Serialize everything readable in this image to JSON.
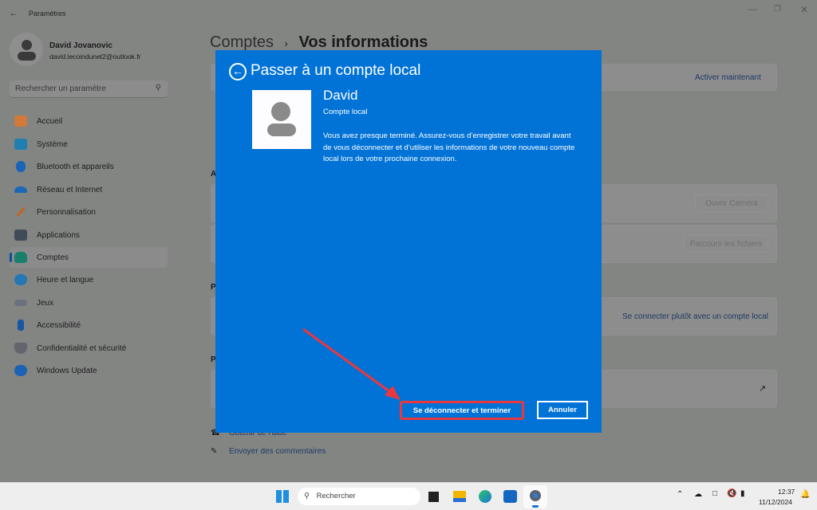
{
  "window": {
    "title": "Paramètres"
  },
  "user": {
    "name": "David Jovanovic",
    "email": "david.lecoindunet2@outlook.fr"
  },
  "search": {
    "placeholder": "Rechercher un paramètre"
  },
  "sidebar": {
    "items": [
      {
        "label": "Accueil",
        "icon": "home-icon",
        "color": "#e07a3a"
      },
      {
        "label": "Système",
        "icon": "system-icon",
        "color": "#1e8fc9"
      },
      {
        "label": "Bluetooth et appareils",
        "icon": "bluetooth-icon",
        "color": "#1b6fd0"
      },
      {
        "label": "Réseau et Internet",
        "icon": "wifi-icon",
        "color": "#1a73c9"
      },
      {
        "label": "Personnalisation",
        "icon": "brush-icon",
        "color": "#c7733a"
      },
      {
        "label": "Applications",
        "icon": "apps-icon",
        "color": "#4b5566"
      },
      {
        "label": "Comptes",
        "icon": "person-icon",
        "color": "#1a8f7a",
        "selected": true
      },
      {
        "label": "Heure et langue",
        "icon": "clock-globe-icon",
        "color": "#2a86c9"
      },
      {
        "label": "Jeux",
        "icon": "gamepad-icon",
        "color": "#6f7a8a"
      },
      {
        "label": "Accessibilité",
        "icon": "accessibility-icon",
        "color": "#1a5fb4"
      },
      {
        "label": "Confidentialité et sécurité",
        "icon": "shield-icon",
        "color": "#6b6f75"
      },
      {
        "label": "Windows Update",
        "icon": "update-icon",
        "color": "#1a6fc9"
      }
    ]
  },
  "breadcrumb": {
    "parent": "Comptes",
    "current": "Vos informations"
  },
  "content": {
    "activate_link": "Activer maintenant",
    "open_camera": "Ouvrir Caméra",
    "browse_files": "Parcourir les fichiers",
    "local_account_link": "Se connecter plutôt avec un compte local",
    "help": "Obtenir de l'aide",
    "feedback": "Envoyer des commentaires"
  },
  "dialog": {
    "title": "Passer à un compte local",
    "name": "David",
    "account_type": "Compte local",
    "message": "Vous avez presque terminé. Assurez-vous d’enregistrer votre travail avant de vous déconnecter et d’utiliser les informations de votre nouveau compte local lors de votre prochaine connexion.",
    "primary_button": "Se déconnecter et terminer",
    "cancel_button": "Annuler",
    "color": "#0173d7",
    "highlight_color": "#e8383d"
  },
  "taskbar": {
    "search_placeholder": "Rechercher",
    "time": "12:37",
    "date": "11/12/2024"
  }
}
